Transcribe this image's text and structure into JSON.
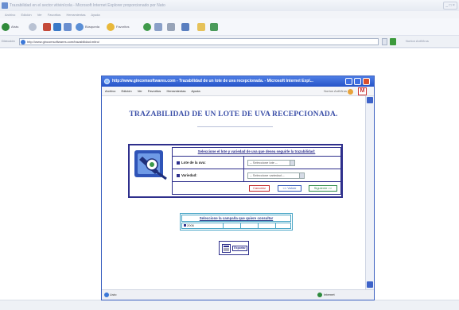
{
  "outer_browser": {
    "title": "Trazabilidad en el sector vitivinícola - Microsoft Internet Explorer proporcionado por Nato",
    "menu": [
      "Archivo",
      "Edición",
      "Ver",
      "Favoritos",
      "Herramientas",
      "Ayuda"
    ],
    "toolbar": {
      "back": "Atrás",
      "search": "Búsqueda",
      "favorites": "Favoritos"
    },
    "address_label": "Dirección",
    "address_url": "http://www.gincomsoftwares.com/trazabilidad.mitro/",
    "links_label": "Norton AntiVirus",
    "window_buttons": "_ □ ×"
  },
  "inner_browser": {
    "title": "http://www.gincomsoftwares.com - Trazabilidad de un lote de uva recepcionada. - Microsoft Internet Expl...",
    "menu": [
      "Archivo",
      "Edición",
      "Ver",
      "Favoritos",
      "Herramientas",
      "Ayuda"
    ],
    "norton_label": "Norton AntiVirus",
    "m_logo": "M",
    "status_left": "Listo",
    "status_right": "Internet"
  },
  "page": {
    "title": "TRAZABILIDAD DE UN LOTE DE UVA RECEPCIONADA.",
    "selection_header": "Seleccione el lote y variedad de uva que desea seguirle la trazabilidad:",
    "lote_label": "Lote de la uva:",
    "lote_value": "-- Seleccione lote --",
    "variedad_label": "Variedad:",
    "variedad_value": "-- Seleccione variedad --",
    "cancel_button": "Cancelar",
    "back_button": "<< Volver",
    "next_button": "Siguiente >>",
    "campaign_header": "Seleccione la campaña que quiere consultar",
    "campaign_year": "2006",
    "action_label": "Exportar"
  }
}
